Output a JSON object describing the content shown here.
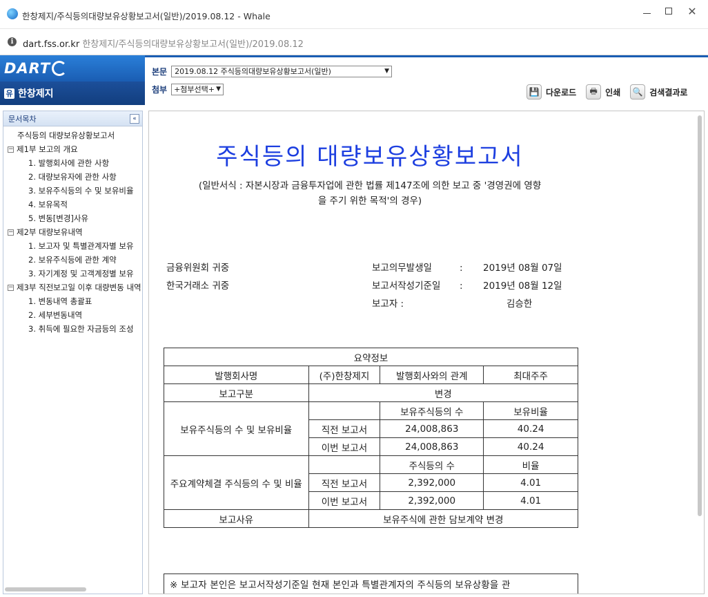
{
  "window": {
    "title": "한창제지/주식등의대량보유상황보고서(일반)/2019.08.12 - Whale"
  },
  "address": {
    "host": "dart.fss.or.kr",
    "path": "한창제지/주식등의대량보유상황보고서(일반)/2019.08.12"
  },
  "header": {
    "logo": "DART",
    "company_badge": "유",
    "company": "한창제지",
    "main_label": "본문",
    "main_select": "2019.08.12   주식등의대량보유상황보고서(일반)",
    "attach_label": "첨부",
    "attach_select": "+첨부선택+",
    "toolbar": {
      "download": "다운로드",
      "print": "인쇄",
      "search_results": "검색결과로"
    }
  },
  "sidebar": {
    "head": "문서목차",
    "collapse": "«",
    "items": [
      {
        "label": "주식등의 대량보유상황보고서"
      },
      {
        "label": "제1부 보고의 개요"
      },
      {
        "label": "1. 발행회사에 관한 사항"
      },
      {
        "label": "2. 대량보유자에 관한 사항"
      },
      {
        "label": "3. 보유주식등의 수 및 보유비율"
      },
      {
        "label": "4. 보유목적"
      },
      {
        "label": "5. 변동[변경]사유"
      },
      {
        "label": "제2부 대량보유내역"
      },
      {
        "label": "1. 보고자 및 특별관계자별 보유"
      },
      {
        "label": "2. 보유주식등에 관한 계약"
      },
      {
        "label": "3. 자기계정 및 고객계정별 보유"
      },
      {
        "label": "제3부 직전보고일 이후 대량변동 내역"
      },
      {
        "label": "1. 변동내역 총괄표"
      },
      {
        "label": "2. 세부변동내역"
      },
      {
        "label": "3. 취득에 필요한 자금등의 조성"
      }
    ]
  },
  "document": {
    "title": "주식등의 대량보유상황보고서",
    "subtitle_line1": "(일반서식 : 자본시장과 금융투자업에 관한 법률 제147조에 의한 보고 중 '경영권에 영향",
    "subtitle_line2": "을 주기 위한 목적'의 경우)",
    "recipient1": "금융위원회 귀중",
    "recipient2": "한국거래소 귀중",
    "obligation_date_label": "보고의무발생일",
    "obligation_date": "2019년 08월 07일",
    "base_date_label": "보고서작성기준일",
    "base_date": "2019년 08월 12일",
    "reporter_label": "보고자 :",
    "reporter": "김승한",
    "colon": ":",
    "summary": {
      "heading": "요약정보",
      "issuer_label": "발행회사명",
      "issuer": "(주)한창제지",
      "relation_label": "발행회사와의 관계",
      "relation": "최대주주",
      "report_type_label": "보고구분",
      "report_type": "변경",
      "holdings_label": "보유주식등의 수 및 보유비율",
      "holdings_count_header": "보유주식등의 수",
      "holdings_ratio_header": "보유비율",
      "prev_report": "직전 보고서",
      "this_report": "이번 보고서",
      "holdings_prev_count": "24,008,863",
      "holdings_prev_ratio": "40.24",
      "holdings_this_count": "24,008,863",
      "holdings_this_ratio": "40.24",
      "contract_label": "주요계약체결 주식등의 수 및 비율",
      "contract_count_header": "주식등의 수",
      "contract_ratio_header": "비율",
      "contract_prev_count": "2,392,000",
      "contract_prev_ratio": "4.01",
      "contract_this_count": "2,392,000",
      "contract_this_ratio": "4.01",
      "reason_label": "보고사유",
      "reason": "보유주식에 관한 담보계약 변경"
    },
    "note": "※ 보고자 본인은 보고서작성기준일 현재 본인과 특별관계자의 주식등의 보유상황을 관"
  }
}
